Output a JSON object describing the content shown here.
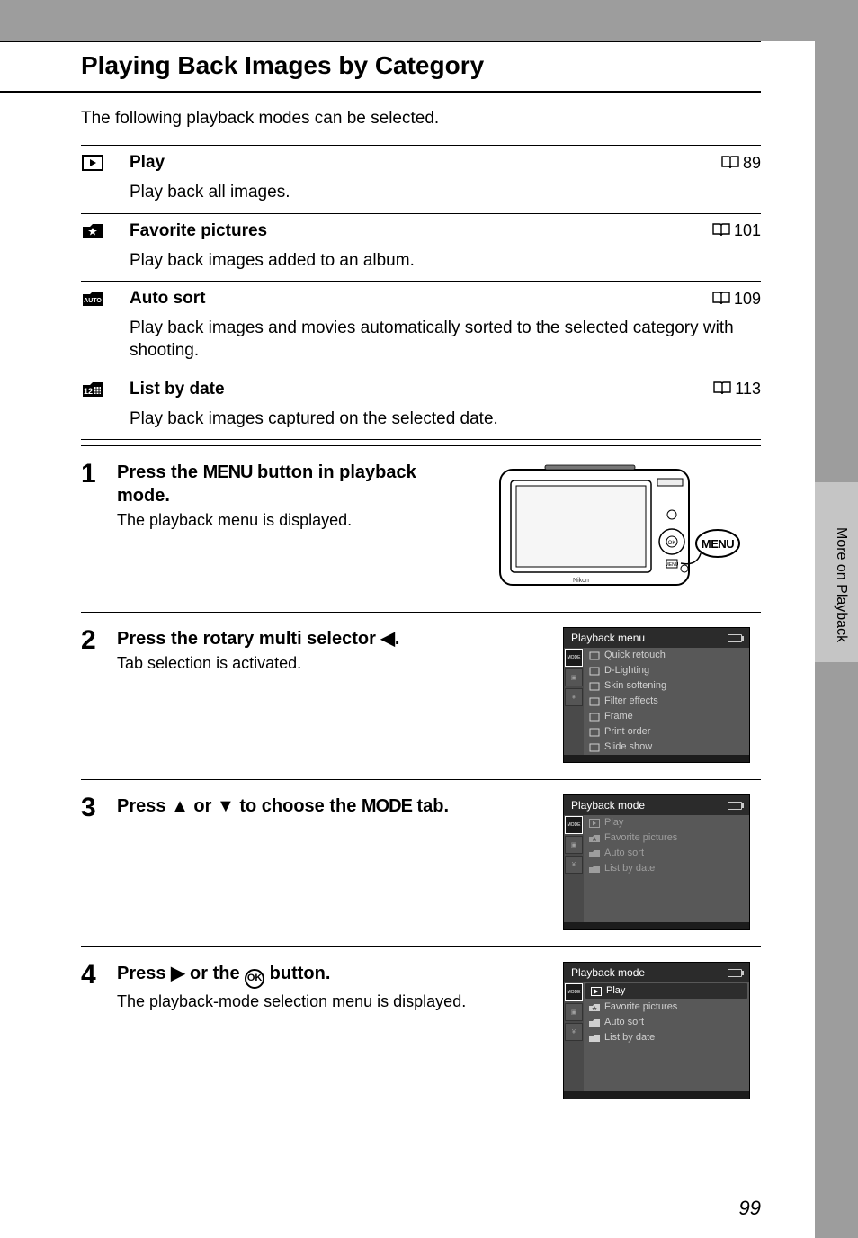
{
  "title": "Playing Back Images by Category",
  "intro": "The following playback modes can be selected.",
  "side_label": "More on Playback",
  "page_number": "99",
  "modes": [
    {
      "name": "Play",
      "page": "89",
      "description": "Play back all images.",
      "icon": "play-icon"
    },
    {
      "name": "Favorite pictures",
      "page": "101",
      "description": "Play back images added to an album.",
      "icon": "star-folder-icon"
    },
    {
      "name": "Auto sort",
      "page": "109",
      "description": "Play back images and movies automatically sorted to the selected category with shooting.",
      "icon": "auto-icon"
    },
    {
      "name": "List by date",
      "page": "113",
      "description": "Play back images captured on the selected date.",
      "icon": "date-icon"
    }
  ],
  "steps": [
    {
      "number": "1",
      "title_pre": "Press the ",
      "title_glyph": "MENU",
      "title_post": " button in playback mode.",
      "subtitle": "The playback menu is displayed.",
      "figure": "camera"
    },
    {
      "number": "2",
      "title_pre": "Press the rotary multi selector ",
      "title_glyph": "◀",
      "title_post": ".",
      "subtitle": "Tab selection is activated.",
      "figure": "lcd_menu",
      "lcd": {
        "title": "Playback menu",
        "tabs_sel": 0,
        "items": [
          "Quick retouch",
          "D-Lighting",
          "Skin softening",
          "Filter effects",
          "Frame",
          "Print order",
          "Slide show"
        ],
        "highlight": -1
      }
    },
    {
      "number": "3",
      "title_pre": "Press ",
      "title_glyph": "▲",
      "title_mid": " or ",
      "title_glyph2": "▼",
      "title_post2": " to choose the ",
      "title_glyph3": "MODE",
      "title_post": " tab.",
      "subtitle": "",
      "figure": "lcd_mode",
      "lcd": {
        "title": "Playback mode",
        "tabs_sel": 0,
        "items": [
          "Play",
          "Favorite pictures",
          "Auto sort",
          "List by date"
        ],
        "dimmed": true,
        "highlight": -1
      }
    },
    {
      "number": "4",
      "title_pre": "Press ",
      "title_glyph": "▶",
      "title_mid": " or the ",
      "title_glyph2": "Ⓚ",
      "title_post": " button.",
      "subtitle": "The playback-mode selection menu is displayed.",
      "figure": "lcd_mode2",
      "lcd": {
        "title": "Playback mode",
        "tabs_sel": 0,
        "items": [
          "Play",
          "Favorite pictures",
          "Auto sort",
          "List by date"
        ],
        "highlight": 0
      }
    }
  ]
}
